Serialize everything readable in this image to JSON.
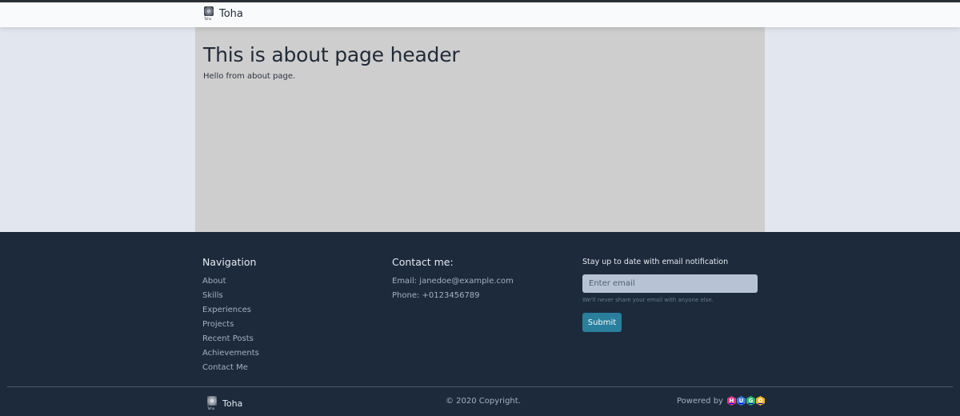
{
  "app": {
    "brand_name": "Toha",
    "brand_tiny": "Toha"
  },
  "content": {
    "title": "This is about page header",
    "body": "Hello from about page."
  },
  "footer": {
    "nav_heading": "Navigation",
    "nav_links": [
      {
        "label": "About"
      },
      {
        "label": "Skills"
      },
      {
        "label": "Experiences"
      },
      {
        "label": "Projects"
      },
      {
        "label": "Recent Posts"
      },
      {
        "label": "Achievements"
      },
      {
        "label": "Contact Me"
      }
    ],
    "contact_heading": "Contact me:",
    "email_line": "Email: janedoe@example.com",
    "phone_line": "Phone: +0123456789",
    "newsletter_heading": "Stay up to date with email notification",
    "email_placeholder": "Enter email",
    "privacy_note": "We'll never share your email with anyone else.",
    "submit_label": "Submit",
    "copyright": "© 2020 Copyright.",
    "powered_by": "Powered by",
    "hugo_letters": [
      {
        "letter": "H",
        "color": "#e03b8a"
      },
      {
        "letter": "U",
        "color": "#3a7bd5"
      },
      {
        "letter": "G",
        "color": "#2bb673"
      },
      {
        "letter": "O",
        "color": "#f0b429"
      }
    ]
  },
  "colors": {
    "navbar_bg": "#f9fafc",
    "content_bg": "#cecece",
    "page_bg": "#e2e6ef",
    "footer_bg": "#1c2a3c",
    "accent": "#2a7f9d"
  }
}
